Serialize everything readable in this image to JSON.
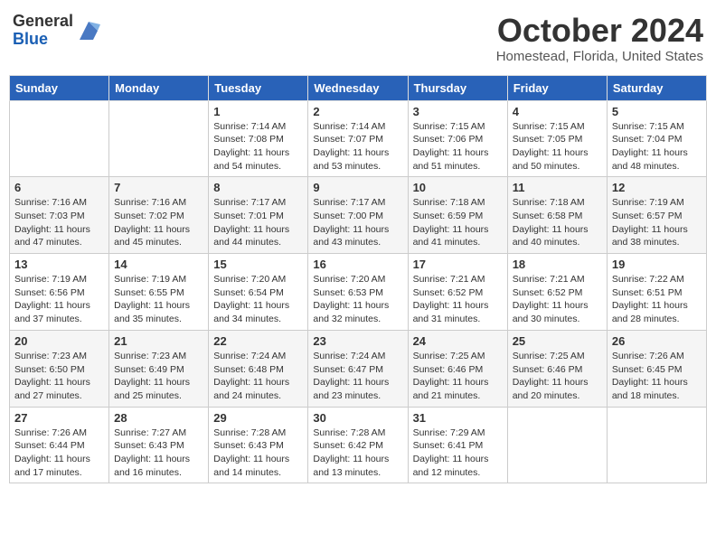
{
  "header": {
    "logo_general": "General",
    "logo_blue": "Blue",
    "title": "October 2024",
    "location": "Homestead, Florida, United States"
  },
  "days_of_week": [
    "Sunday",
    "Monday",
    "Tuesday",
    "Wednesday",
    "Thursday",
    "Friday",
    "Saturday"
  ],
  "weeks": [
    [
      {
        "day": "",
        "info": ""
      },
      {
        "day": "",
        "info": ""
      },
      {
        "day": "1",
        "info": "Sunrise: 7:14 AM\nSunset: 7:08 PM\nDaylight: 11 hours and 54 minutes."
      },
      {
        "day": "2",
        "info": "Sunrise: 7:14 AM\nSunset: 7:07 PM\nDaylight: 11 hours and 53 minutes."
      },
      {
        "day": "3",
        "info": "Sunrise: 7:15 AM\nSunset: 7:06 PM\nDaylight: 11 hours and 51 minutes."
      },
      {
        "day": "4",
        "info": "Sunrise: 7:15 AM\nSunset: 7:05 PM\nDaylight: 11 hours and 50 minutes."
      },
      {
        "day": "5",
        "info": "Sunrise: 7:15 AM\nSunset: 7:04 PM\nDaylight: 11 hours and 48 minutes."
      }
    ],
    [
      {
        "day": "6",
        "info": "Sunrise: 7:16 AM\nSunset: 7:03 PM\nDaylight: 11 hours and 47 minutes."
      },
      {
        "day": "7",
        "info": "Sunrise: 7:16 AM\nSunset: 7:02 PM\nDaylight: 11 hours and 45 minutes."
      },
      {
        "day": "8",
        "info": "Sunrise: 7:17 AM\nSunset: 7:01 PM\nDaylight: 11 hours and 44 minutes."
      },
      {
        "day": "9",
        "info": "Sunrise: 7:17 AM\nSunset: 7:00 PM\nDaylight: 11 hours and 43 minutes."
      },
      {
        "day": "10",
        "info": "Sunrise: 7:18 AM\nSunset: 6:59 PM\nDaylight: 11 hours and 41 minutes."
      },
      {
        "day": "11",
        "info": "Sunrise: 7:18 AM\nSunset: 6:58 PM\nDaylight: 11 hours and 40 minutes."
      },
      {
        "day": "12",
        "info": "Sunrise: 7:19 AM\nSunset: 6:57 PM\nDaylight: 11 hours and 38 minutes."
      }
    ],
    [
      {
        "day": "13",
        "info": "Sunrise: 7:19 AM\nSunset: 6:56 PM\nDaylight: 11 hours and 37 minutes."
      },
      {
        "day": "14",
        "info": "Sunrise: 7:19 AM\nSunset: 6:55 PM\nDaylight: 11 hours and 35 minutes."
      },
      {
        "day": "15",
        "info": "Sunrise: 7:20 AM\nSunset: 6:54 PM\nDaylight: 11 hours and 34 minutes."
      },
      {
        "day": "16",
        "info": "Sunrise: 7:20 AM\nSunset: 6:53 PM\nDaylight: 11 hours and 32 minutes."
      },
      {
        "day": "17",
        "info": "Sunrise: 7:21 AM\nSunset: 6:52 PM\nDaylight: 11 hours and 31 minutes."
      },
      {
        "day": "18",
        "info": "Sunrise: 7:21 AM\nSunset: 6:52 PM\nDaylight: 11 hours and 30 minutes."
      },
      {
        "day": "19",
        "info": "Sunrise: 7:22 AM\nSunset: 6:51 PM\nDaylight: 11 hours and 28 minutes."
      }
    ],
    [
      {
        "day": "20",
        "info": "Sunrise: 7:23 AM\nSunset: 6:50 PM\nDaylight: 11 hours and 27 minutes."
      },
      {
        "day": "21",
        "info": "Sunrise: 7:23 AM\nSunset: 6:49 PM\nDaylight: 11 hours and 25 minutes."
      },
      {
        "day": "22",
        "info": "Sunrise: 7:24 AM\nSunset: 6:48 PM\nDaylight: 11 hours and 24 minutes."
      },
      {
        "day": "23",
        "info": "Sunrise: 7:24 AM\nSunset: 6:47 PM\nDaylight: 11 hours and 23 minutes."
      },
      {
        "day": "24",
        "info": "Sunrise: 7:25 AM\nSunset: 6:46 PM\nDaylight: 11 hours and 21 minutes."
      },
      {
        "day": "25",
        "info": "Sunrise: 7:25 AM\nSunset: 6:46 PM\nDaylight: 11 hours and 20 minutes."
      },
      {
        "day": "26",
        "info": "Sunrise: 7:26 AM\nSunset: 6:45 PM\nDaylight: 11 hours and 18 minutes."
      }
    ],
    [
      {
        "day": "27",
        "info": "Sunrise: 7:26 AM\nSunset: 6:44 PM\nDaylight: 11 hours and 17 minutes."
      },
      {
        "day": "28",
        "info": "Sunrise: 7:27 AM\nSunset: 6:43 PM\nDaylight: 11 hours and 16 minutes."
      },
      {
        "day": "29",
        "info": "Sunrise: 7:28 AM\nSunset: 6:43 PM\nDaylight: 11 hours and 14 minutes."
      },
      {
        "day": "30",
        "info": "Sunrise: 7:28 AM\nSunset: 6:42 PM\nDaylight: 11 hours and 13 minutes."
      },
      {
        "day": "31",
        "info": "Sunrise: 7:29 AM\nSunset: 6:41 PM\nDaylight: 11 hours and 12 minutes."
      },
      {
        "day": "",
        "info": ""
      },
      {
        "day": "",
        "info": ""
      }
    ]
  ]
}
